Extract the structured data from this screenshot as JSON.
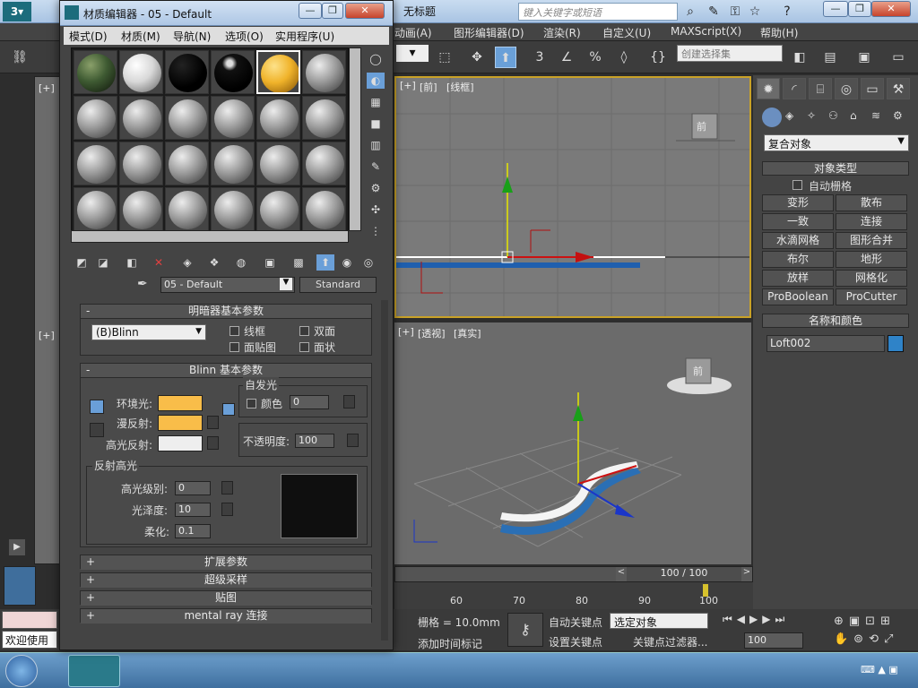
{
  "app": {
    "title": "无标题",
    "search_placeholder": "键入关键字或短语",
    "menus": [
      "动画(A)",
      "图形编辑器(D)",
      "渲染(R)",
      "自定义(U)",
      "MAXScript(X)",
      "帮助(H)"
    ],
    "selection_set": "创建选择集"
  },
  "viewports": {
    "top_left_label": "[+]",
    "front": {
      "plus": "[+]",
      "view": "[前]",
      "mode": "[线框]",
      "cube": "前"
    },
    "persp": {
      "plus": "[+]",
      "view": "[透视]",
      "mode": "[真实]",
      "cube": "前"
    }
  },
  "command_panel": {
    "category": "复合对象",
    "object_type_title": "对象类型",
    "autogrid": "自动栅格",
    "buttons": [
      "变形",
      "散布",
      "一致",
      "连接",
      "水滴网格",
      "图形合并",
      "布尔",
      "地形",
      "放样",
      "网格化",
      "ProBoolean",
      "ProCutter"
    ],
    "name_color_title": "名称和颜色",
    "object_name": "Loft002",
    "object_color": "#2f83c8"
  },
  "timeline": {
    "frame_display": "100 / 100",
    "ticks": [
      "60",
      "70",
      "80",
      "90",
      "100"
    ],
    "grid": "栅格 = 10.0mm",
    "auto_key": "自动关键点",
    "set_key": "设置关键点",
    "key_mode": "选定对象",
    "key_filters": "关键点过滤器...",
    "add_time_tag": "添加时间标记",
    "frame_value": "100",
    "status": "欢迎使用"
  },
  "material_editor": {
    "title": "材质编辑器 - 05 - Default",
    "menus": [
      "模式(D)",
      "材质(M)",
      "导航(N)",
      "选项(O)",
      "实用程序(U)"
    ],
    "material_name": "05 - Default",
    "material_type": "Standard",
    "shader_rollout": {
      "title": "明暗器基本参数",
      "shader": "(B)Blinn",
      "wire": "线框",
      "two_sided": "双面",
      "face_map": "面贴图",
      "faceted": "面状"
    },
    "blinn_rollout": {
      "title": "Blinn 基本参数",
      "self_illum_title": "自发光",
      "color_label": "颜色",
      "color_value": "0",
      "ambient": "环境光:",
      "diffuse": "漫反射:",
      "specular": "高光反射:",
      "ambient_color": "#f9bd49",
      "diffuse_color": "#f9bd49",
      "specular_color": "#eeeeee",
      "opacity_label": "不透明度:",
      "opacity_value": "100",
      "highlights_title": "反射高光",
      "spec_level_label": "高光级别:",
      "spec_level": "0",
      "glossiness_label": "光泽度:",
      "glossiness": "10",
      "soften_label": "柔化:",
      "soften": "0.1"
    },
    "collapsed_rollouts": [
      "扩展参数",
      "超级采样",
      "贴图",
      "mental ray 连接"
    ]
  }
}
